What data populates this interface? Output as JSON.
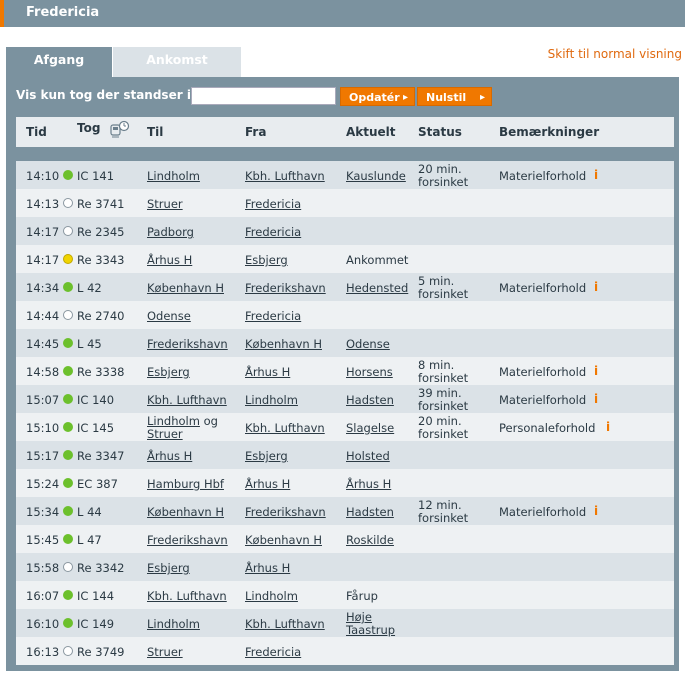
{
  "header": {
    "title": "Fredericia",
    "accent_color": "#f07800",
    "bar_color": "#7b929f"
  },
  "tabs": [
    {
      "label": "Afgang",
      "active": true
    },
    {
      "label": "Ankomst",
      "active": false
    }
  ],
  "switch_link": "Skift til normal visning",
  "filter": {
    "label": "Vis kun tog der standser i:",
    "value": "",
    "update_label": "Opdatér",
    "reset_label": "Nulstil"
  },
  "columns": {
    "tid": "Tid",
    "tog": "Tog",
    "til": "Til",
    "fra": "Fra",
    "aktuelt": "Aktuelt",
    "status": "Status",
    "bemaerkninger": "Bemærkninger"
  },
  "rows": [
    {
      "time": "14:10",
      "dot": "green",
      "train": "IC 141",
      "to": [
        "Lindholm"
      ],
      "from": "Kbh. Lufthavn",
      "current": [
        "Kauslunde"
      ],
      "current_link": true,
      "status": [
        "20 min.",
        "forsinket"
      ],
      "remark": "Materielforhold",
      "info": true
    },
    {
      "time": "14:13",
      "dot": "empty",
      "train": "Re 3741",
      "to": [
        "Struer"
      ],
      "from": "Fredericia",
      "current": [],
      "current_link": false,
      "status": [],
      "remark": "",
      "info": false
    },
    {
      "time": "14:17",
      "dot": "empty",
      "train": "Re 2345",
      "to": [
        "Padborg"
      ],
      "from": "Fredericia",
      "current": [],
      "current_link": false,
      "status": [],
      "remark": "",
      "info": false
    },
    {
      "time": "14:17",
      "dot": "yellow",
      "train": "Re 3343",
      "to": [
        "Århus H"
      ],
      "from": "Esbjerg",
      "current": [
        "Ankommet"
      ],
      "current_link": false,
      "status": [],
      "remark": "",
      "info": false
    },
    {
      "time": "14:34",
      "dot": "green",
      "train": "L 42",
      "to": [
        "København H"
      ],
      "from": "Frederikshavn",
      "current": [
        "Hedensted"
      ],
      "current_link": true,
      "status": [
        "5 min.",
        "forsinket"
      ],
      "remark": "Materielforhold",
      "info": true
    },
    {
      "time": "14:44",
      "dot": "empty",
      "train": "Re 2740",
      "to": [
        "Odense"
      ],
      "from": "Fredericia",
      "current": [],
      "current_link": false,
      "status": [],
      "remark": "",
      "info": false
    },
    {
      "time": "14:45",
      "dot": "green",
      "train": "L 45",
      "to": [
        "Frederikshavn"
      ],
      "from": "København H",
      "current": [
        "Odense"
      ],
      "current_link": true,
      "status": [],
      "remark": "",
      "info": false
    },
    {
      "time": "14:58",
      "dot": "green",
      "train": "Re 3338",
      "to": [
        "Esbjerg"
      ],
      "from": "Århus H",
      "current": [
        "Horsens"
      ],
      "current_link": true,
      "status": [
        "8 min.",
        "forsinket"
      ],
      "remark": "Materielforhold",
      "info": true
    },
    {
      "time": "15:07",
      "dot": "green",
      "train": "IC 140",
      "to": [
        "Kbh. Lufthavn"
      ],
      "from": "Lindholm",
      "current": [
        "Hadsten"
      ],
      "current_link": true,
      "status": [
        "39 min.",
        "forsinket"
      ],
      "remark": "Materielforhold",
      "info": true
    },
    {
      "time": "15:10",
      "dot": "green",
      "train": "IC 145",
      "to": [
        "Lindholm",
        "og",
        "Struer"
      ],
      "from": "Kbh. Lufthavn",
      "current": [
        "Slagelse"
      ],
      "current_link": true,
      "status": [
        "20 min.",
        "forsinket"
      ],
      "remark": "Personaleforhold",
      "info": true
    },
    {
      "time": "15:17",
      "dot": "green",
      "train": "Re 3347",
      "to": [
        "Århus H"
      ],
      "from": "Esbjerg",
      "current": [
        "Holsted"
      ],
      "current_link": true,
      "status": [],
      "remark": "",
      "info": false
    },
    {
      "time": "15:24",
      "dot": "green",
      "train": "EC 387",
      "to": [
        "Hamburg Hbf"
      ],
      "from": "Århus H",
      "current": [
        "Århus H"
      ],
      "current_link": true,
      "status": [],
      "remark": "",
      "info": false
    },
    {
      "time": "15:34",
      "dot": "green",
      "train": "L 44",
      "to": [
        "København H"
      ],
      "from": "Frederikshavn",
      "current": [
        "Hadsten"
      ],
      "current_link": true,
      "status": [
        "12 min.",
        "forsinket"
      ],
      "remark": "Materielforhold",
      "info": true
    },
    {
      "time": "15:45",
      "dot": "green",
      "train": "L 47",
      "to": [
        "Frederikshavn"
      ],
      "from": "København H",
      "current": [
        "Roskilde"
      ],
      "current_link": true,
      "status": [],
      "remark": "",
      "info": false
    },
    {
      "time": "15:58",
      "dot": "empty",
      "train": "Re 3342",
      "to": [
        "Esbjerg"
      ],
      "from": "Århus H",
      "current": [],
      "current_link": false,
      "status": [],
      "remark": "",
      "info": false
    },
    {
      "time": "16:07",
      "dot": "green",
      "train": "IC 144",
      "to": [
        "Kbh. Lufthavn"
      ],
      "from": "Lindholm",
      "current": [
        "Fårup"
      ],
      "current_link": false,
      "status": [],
      "remark": "",
      "info": false
    },
    {
      "time": "16:10",
      "dot": "green",
      "train": "IC 149",
      "to": [
        "Lindholm"
      ],
      "from": "Kbh. Lufthavn",
      "current": [
        "Høje",
        "Taastrup"
      ],
      "current_link": true,
      "status": [],
      "remark": "",
      "info": false
    },
    {
      "time": "16:13",
      "dot": "empty",
      "train": "Re 3749",
      "to": [
        "Struer"
      ],
      "from": "Fredericia",
      "current": [],
      "current_link": false,
      "status": [],
      "remark": "",
      "info": false
    }
  ],
  "info_glyph": "i"
}
